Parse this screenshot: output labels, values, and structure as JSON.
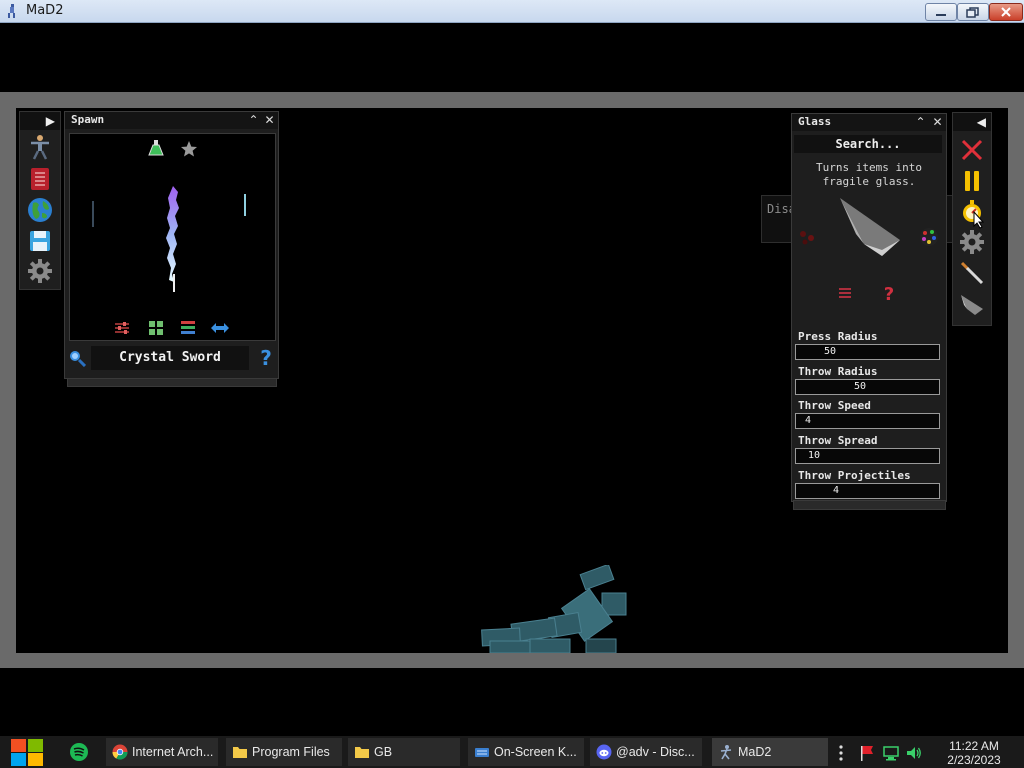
{
  "window": {
    "title": "MaD2",
    "controls": [
      "minimize",
      "maximize",
      "close"
    ]
  },
  "left_toolbar": {
    "expand_icon": "chevron-right-icon",
    "items": [
      {
        "name": "ragdoll-tool",
        "icon": "stickman-icon"
      },
      {
        "name": "catalog",
        "icon": "red-book-icon"
      },
      {
        "name": "world",
        "icon": "globe-icon"
      },
      {
        "name": "save",
        "icon": "floppy-disk-icon"
      },
      {
        "name": "settings",
        "icon": "gear-icon"
      }
    ]
  },
  "spawn_panel": {
    "title": "Spawn",
    "top_icons": [
      "potion-icon",
      "star-icon"
    ],
    "bottom_icons": [
      "sliders-icon",
      "grid-icon",
      "list-icon",
      "swap-arrows-icon"
    ],
    "item_name": "Crystal Sword",
    "search_icon": "magnifier-icon",
    "help_icon": "question-icon"
  },
  "glass_panel": {
    "title": "Glass",
    "search_placeholder": "Search...",
    "description": "Turns items into fragile glass.",
    "fields": [
      {
        "label": "Press Radius",
        "value": "50"
      },
      {
        "label": "Throw Radius",
        "value": "50"
      },
      {
        "label": "Throw Speed",
        "value": "4"
      },
      {
        "label": "Throw Spread",
        "value": "10"
      },
      {
        "label": "Throw Projectiles",
        "value": "4"
      }
    ]
  },
  "right_toolbar": {
    "collapse_icon": "chevron-left-icon",
    "items": [
      {
        "name": "clear",
        "icon": "red-x-icon"
      },
      {
        "name": "pause",
        "icon": "pause-icon"
      },
      {
        "name": "slow-motion",
        "icon": "stopwatch-icon"
      },
      {
        "name": "settings",
        "icon": "gear-icon"
      },
      {
        "name": "weapon",
        "icon": "knife-icon"
      },
      {
        "name": "glass",
        "icon": "glass-shard-icon"
      }
    ]
  },
  "tooltip": {
    "text": "Disable slow motion."
  },
  "taskbar": {
    "tasks": [
      {
        "label": "Internet Arch...",
        "icon": "chrome-icon"
      },
      {
        "label": "Program Files",
        "icon": "folder-icon"
      },
      {
        "label": "GB",
        "icon": "folder-icon"
      },
      {
        "label": "On-Screen K...",
        "icon": "keyboard-icon"
      },
      {
        "label": "@adv - Disc...",
        "icon": "discord-icon"
      },
      {
        "label": "MaD2",
        "icon": "mad2-icon"
      }
    ],
    "clock": {
      "time": "11:22 AM",
      "date": "2/23/2023"
    }
  },
  "colors": {
    "panel_bg": "#1e1e1e",
    "game_bg": "#000000",
    "frame_bg": "#6a6a6a",
    "taskbar_bg": "#1a1a1a",
    "accent_blue": "#4aa3df",
    "red": "#e0303a"
  }
}
